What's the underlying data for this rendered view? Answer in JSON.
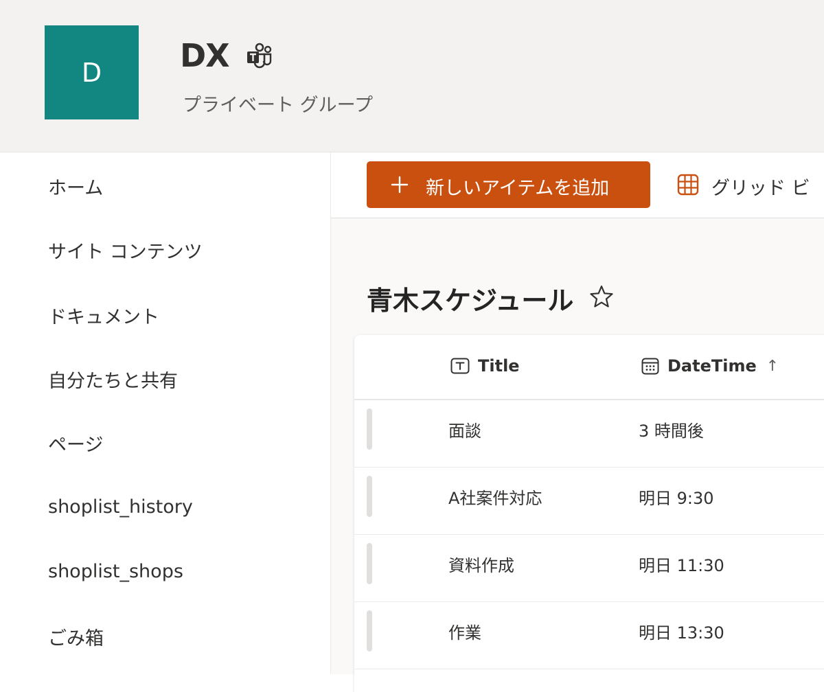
{
  "header": {
    "logo_letter": "D",
    "logo_color": "#128781",
    "title": "DX",
    "teams_icon": "teams-icon",
    "subtitle": "プライベート グループ"
  },
  "sidebar": {
    "items": [
      {
        "label": "ホーム"
      },
      {
        "label": "サイト コンテンツ"
      },
      {
        "label": "ドキュメント"
      },
      {
        "label": "自分たちと共有"
      },
      {
        "label": "ページ"
      },
      {
        "label": "shoplist_history"
      },
      {
        "label": "shoplist_shops"
      },
      {
        "label": "ごみ箱"
      }
    ]
  },
  "toolbar": {
    "new_item_label": "新しいアイテムを追加",
    "new_item_color": "#ca5010",
    "grid_view_label": "グリッド ビ"
  },
  "list": {
    "title": "青木スケジュール",
    "columns": [
      {
        "label": "Title",
        "icon": "text-field-icon"
      },
      {
        "label": "DateTime",
        "icon": "calendar-icon",
        "sort": "ascending"
      }
    ],
    "sort_arrow": "↑",
    "rows": [
      {
        "title": "面談",
        "datetime": "3 時間後"
      },
      {
        "title": "A社案件対応",
        "datetime": "明日 9:30"
      },
      {
        "title": "資料作成",
        "datetime": "明日 11:30"
      },
      {
        "title": "作業",
        "datetime": "明日 13:30"
      }
    ]
  }
}
